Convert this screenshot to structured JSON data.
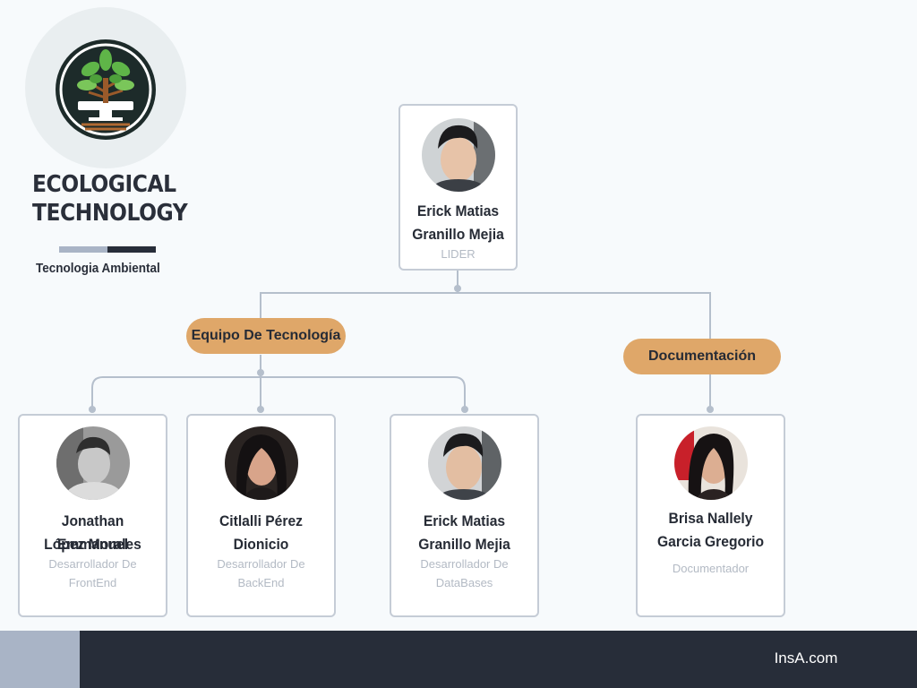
{
  "brand": {
    "title_line1": "ECOLOGICAL",
    "title_line2": "TECHNOLOGY",
    "subtitle": "Tecnologia Ambiental",
    "logo_icon": "tree-computer-icon"
  },
  "colors": {
    "background": "#f7fafc",
    "pill": "#dfa769",
    "connector": "#b5bfcc",
    "footer_dark": "#272d39",
    "footer_light": "#a9b4c6"
  },
  "org": {
    "leader": {
      "name_line1": "Erick Matias",
      "name_line2": "Granillo Mejia",
      "role_line1": "LIDER"
    },
    "groups": [
      {
        "label": "Equipo De Tecnología"
      },
      {
        "label": "Documentación"
      }
    ],
    "members": [
      {
        "name_line1": "Jonathan Emmanuel",
        "name_line2": "López Morales",
        "role_line1": "Desarrollador De",
        "role_line2": "FrontEnd"
      },
      {
        "name_line1": "Citlalli Pérez",
        "name_line2": "Dionicio",
        "role_line1": "Desarrollador De",
        "role_line2": "BackEnd"
      },
      {
        "name_line1": "Erick Matias",
        "name_line2": "Granillo Mejia",
        "role_line1": "Desarrollador De",
        "role_line2": "DataBases"
      },
      {
        "name_line1": "Brisa Nallely",
        "name_line2": "Garcia Gregorio",
        "role_line1": "Documentador"
      }
    ]
  },
  "footer": {
    "website": "InsA.com"
  }
}
